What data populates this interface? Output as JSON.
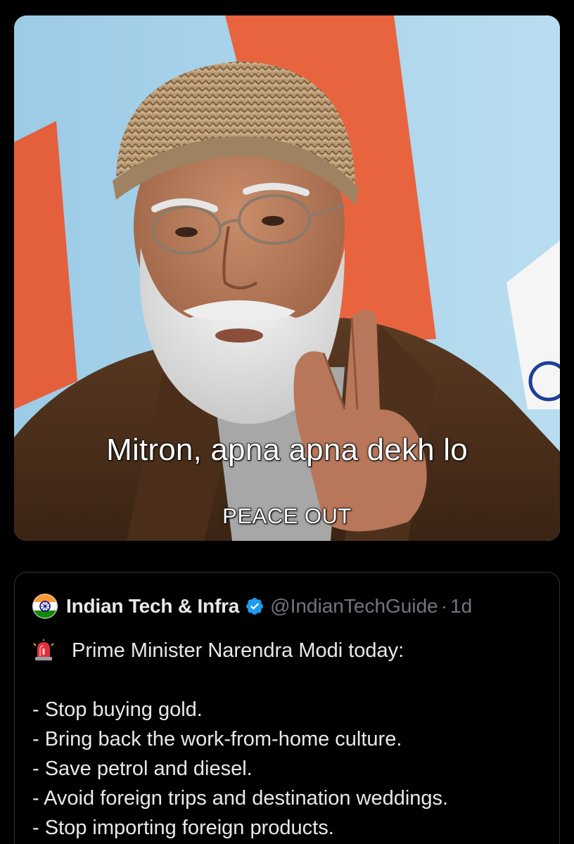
{
  "media": {
    "caption_main": "Mitron, apna apna dekh lo",
    "caption_sub": "PEACE OUT"
  },
  "quote": {
    "author_name": "Indian Tech & Infra",
    "handle": "@IndianTechGuide",
    "separator": "·",
    "time": "1d",
    "avatar_icon": "ashoka-chakra-icon",
    "verified_icon": "verified-badge-icon",
    "verified_color": "#1d9bf0",
    "intro_icon": "siren-icon",
    "intro": "Prime Minister Narendra Modi today:",
    "bullets": [
      "- Stop buying gold.",
      "- Bring back the work-from-home culture.",
      "- Save petrol and diesel.",
      "- Avoid foreign trips and destination weddings.",
      "- Stop importing foreign products."
    ]
  },
  "colors": {
    "background": "#000000",
    "primary_text": "#e7e9ea",
    "secondary_text": "#71767b",
    "border": "#2f3336"
  }
}
